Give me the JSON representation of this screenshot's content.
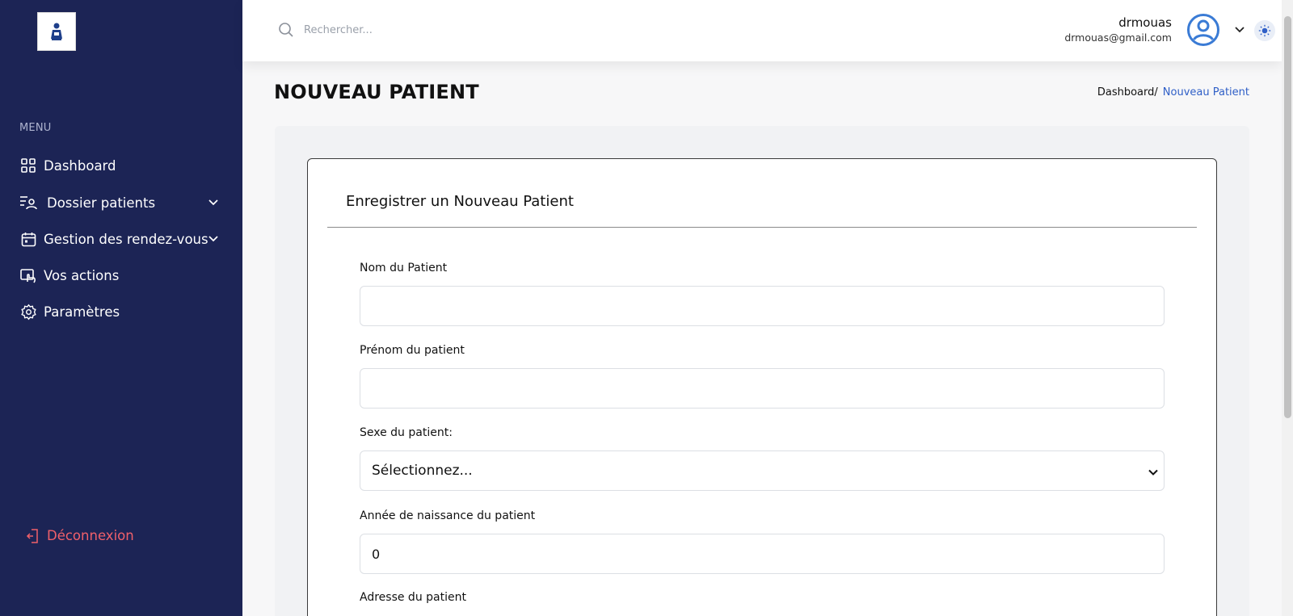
{
  "sidebar": {
    "menu_title": "MENU",
    "items": [
      {
        "label": "Dashboard",
        "icon": "grid-icon",
        "has_submenu": false
      },
      {
        "label": "Dossier patients",
        "icon": "patient-list-icon",
        "has_submenu": true
      },
      {
        "label": "Gestion des rendez-vous",
        "icon": "calendar-icon",
        "has_submenu": true
      },
      {
        "label": "Vos actions",
        "icon": "actions-icon",
        "has_submenu": false
      },
      {
        "label": "Paramètres",
        "icon": "gear-icon",
        "has_submenu": false
      }
    ],
    "logout_label": "Déconnexion"
  },
  "header": {
    "search_placeholder": "Rechercher...",
    "user_name": "drmouas",
    "user_email": "drmouas@gmail.com"
  },
  "page": {
    "title": "NOUVEAU PATIENT",
    "breadcrumb_home": "Dashboard/",
    "breadcrumb_current": "Nouveau Patient"
  },
  "form": {
    "title": "Enregistrer un Nouveau Patient",
    "fields": {
      "nom_label": "Nom du Patient",
      "nom_value": "",
      "prenom_label": "Prénom du patient",
      "prenom_value": "",
      "sexe_label": "Sexe du patient:",
      "sexe_selected": "Sélectionnez...",
      "annee_label": "Année de naissance du patient",
      "annee_value": "0",
      "adresse_label": "Adresse du patient"
    }
  },
  "colors": {
    "sidebar_bg": "#1c2455",
    "accent": "#2f5fc7",
    "logout": "#f0606a"
  }
}
